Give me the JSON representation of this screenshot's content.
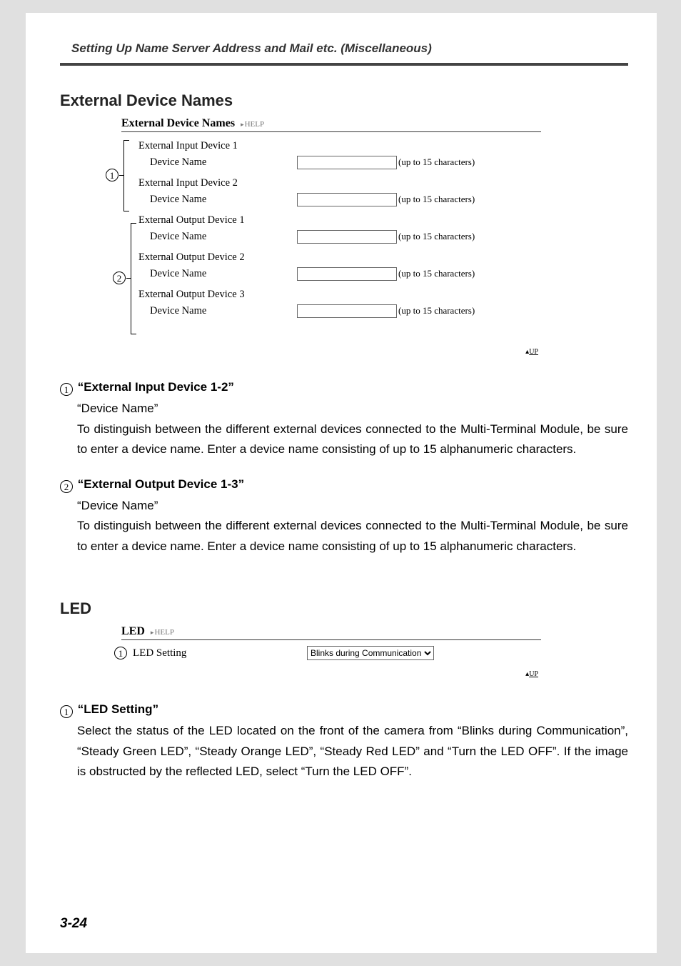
{
  "header": {
    "title": "Setting Up Name Server Address and Mail etc. (Miscellaneous)"
  },
  "section1": {
    "heading": "External Device Names",
    "panel_title": "External Device Names",
    "help": "HELP",
    "hint": "(up to 15 characters)",
    "device_name_label": "Device Name",
    "up": "UP",
    "input_devices": [
      {
        "title": "External Input Device 1",
        "value": ""
      },
      {
        "title": "External Input Device 2",
        "value": ""
      }
    ],
    "output_devices": [
      {
        "title": "External Output Device 1",
        "value": ""
      },
      {
        "title": "External Output Device 2",
        "value": ""
      },
      {
        "title": "External Output Device 3",
        "value": ""
      }
    ],
    "callouts": {
      "c1": "1",
      "c2": "2"
    },
    "desc": [
      {
        "num": "1",
        "title": "“External Input Device 1-2”",
        "sub": "“Device Name”",
        "body": "To distinguish between the different external devices connected to the Multi-Terminal Module, be sure to enter a device name. Enter a device name consisting of up to 15 alphanumeric characters."
      },
      {
        "num": "2",
        "title": "“External Output Device 1-3”",
        "sub": "“Device Name”",
        "body": "To distinguish between the different external devices connected to the Multi-Terminal Module, be sure to enter a device name. Enter a device name consisting of up to 15 alphanumeric characters."
      }
    ]
  },
  "section2": {
    "heading": "LED",
    "panel_title": "LED",
    "help": "HELP",
    "up": "UP",
    "callout": "1",
    "row_label": "LED Setting",
    "select_value": "Blinks during Communication",
    "desc": {
      "num": "1",
      "title": "“LED Setting”",
      "body": "Select the status of the LED located on the front of the camera from “Blinks during Communication”, “Steady Green LED”, “Steady Orange LED”, “Steady Red LED” and “Turn the LED OFF”. If the image is obstructed by the reflected LED, select “Turn the LED OFF”."
    }
  },
  "page_number": "3-24"
}
